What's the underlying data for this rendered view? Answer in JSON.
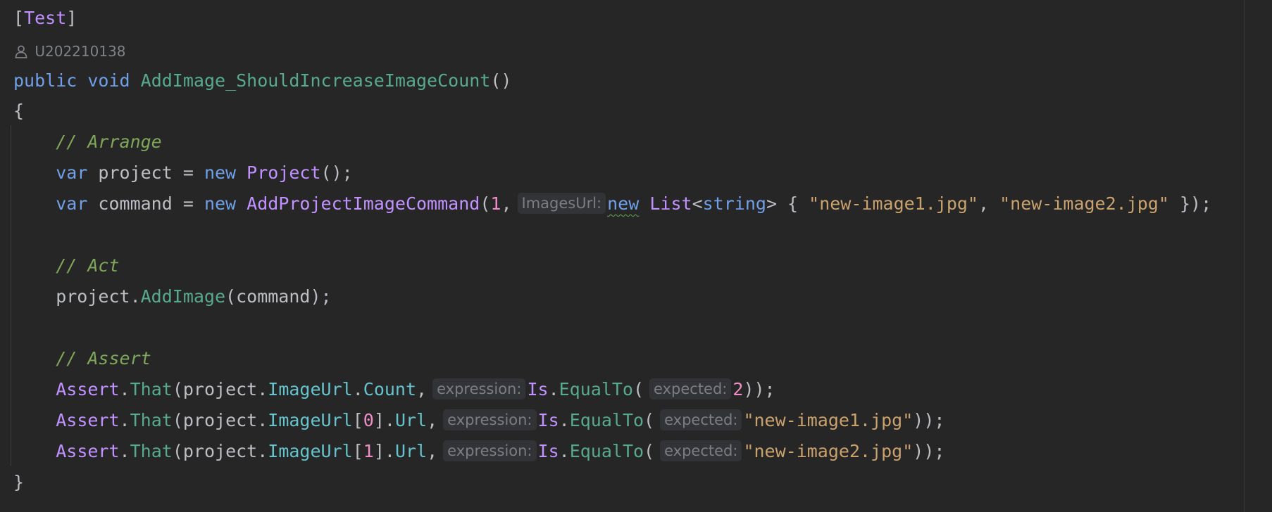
{
  "editor": {
    "author": {
      "icon": "user-icon",
      "name": "U202210138"
    },
    "lines": [
      {
        "id": "attribute",
        "tokens": [
          {
            "text": "[",
            "kind": "txt"
          },
          {
            "text": "Test",
            "kind": "cls"
          },
          {
            "text": "]",
            "kind": "txt"
          }
        ]
      },
      {
        "id": "method-signature",
        "tokens": [
          {
            "text": "public",
            "kind": "kw"
          },
          {
            "text": " ",
            "kind": "txt"
          },
          {
            "text": "void",
            "kind": "kw"
          },
          {
            "text": " ",
            "kind": "txt"
          },
          {
            "text": "AddImage_ShouldIncreaseImageCount",
            "kind": "fn"
          },
          {
            "text": "()",
            "kind": "txt"
          }
        ]
      },
      {
        "id": "open-brace",
        "tokens": [
          {
            "text": "{",
            "kind": "txt"
          }
        ]
      },
      {
        "id": "comment-arrange",
        "tokens": [
          {
            "text": "    ",
            "kind": "txt"
          },
          {
            "text": "// Arrange",
            "kind": "com"
          }
        ]
      },
      {
        "id": "var-project",
        "tokens": [
          {
            "text": "    ",
            "kind": "txt"
          },
          {
            "text": "var",
            "kind": "kw"
          },
          {
            "text": " project = ",
            "kind": "txt"
          },
          {
            "text": "new",
            "kind": "kw"
          },
          {
            "text": " ",
            "kind": "txt"
          },
          {
            "text": "Project",
            "kind": "cls"
          },
          {
            "text": "();",
            "kind": "txt"
          }
        ]
      },
      {
        "id": "var-command",
        "tokens": [
          {
            "text": "    ",
            "kind": "txt"
          },
          {
            "text": "var",
            "kind": "kw"
          },
          {
            "text": " command = ",
            "kind": "txt"
          },
          {
            "text": "new",
            "kind": "kw"
          },
          {
            "text": " ",
            "kind": "txt"
          },
          {
            "text": "AddProjectImageCommand",
            "kind": "cls"
          },
          {
            "text": "(",
            "kind": "txt"
          },
          {
            "text": "1",
            "kind": "num"
          },
          {
            "text": ",",
            "kind": "txt"
          },
          {
            "text": "ImagesUrl:",
            "kind": "hint"
          },
          {
            "text": "new",
            "kind": "kw",
            "squiggle": true
          },
          {
            "text": " ",
            "kind": "txt"
          },
          {
            "text": "List",
            "kind": "cls"
          },
          {
            "text": "<",
            "kind": "txt"
          },
          {
            "text": "string",
            "kind": "kw"
          },
          {
            "text": "> { ",
            "kind": "txt"
          },
          {
            "text": "\"new-image1.jpg\"",
            "kind": "str"
          },
          {
            "text": ", ",
            "kind": "txt"
          },
          {
            "text": "\"new-image2.jpg\"",
            "kind": "str"
          },
          {
            "text": " });",
            "kind": "txt"
          }
        ]
      },
      {
        "id": "blank-1",
        "tokens": []
      },
      {
        "id": "comment-act",
        "tokens": [
          {
            "text": "    ",
            "kind": "txt"
          },
          {
            "text": "// Act",
            "kind": "com"
          }
        ]
      },
      {
        "id": "add-image-call",
        "tokens": [
          {
            "text": "    project.",
            "kind": "txt"
          },
          {
            "text": "AddImage",
            "kind": "fn"
          },
          {
            "text": "(command);",
            "kind": "txt"
          }
        ]
      },
      {
        "id": "blank-2",
        "tokens": []
      },
      {
        "id": "comment-assert",
        "tokens": [
          {
            "text": "    ",
            "kind": "txt"
          },
          {
            "text": "// Assert",
            "kind": "com"
          }
        ]
      },
      {
        "id": "assert-count",
        "tokens": [
          {
            "text": "    ",
            "kind": "txt"
          },
          {
            "text": "Assert",
            "kind": "cls"
          },
          {
            "text": ".",
            "kind": "txt"
          },
          {
            "text": "That",
            "kind": "fn"
          },
          {
            "text": "(project.",
            "kind": "txt"
          },
          {
            "text": "ImageUrl",
            "kind": "prop"
          },
          {
            "text": ".",
            "kind": "txt"
          },
          {
            "text": "Count",
            "kind": "prop"
          },
          {
            "text": ",",
            "kind": "txt"
          },
          {
            "text": "expression:",
            "kind": "hint"
          },
          {
            "text": "Is",
            "kind": "cls"
          },
          {
            "text": ".",
            "kind": "txt"
          },
          {
            "text": "EqualTo",
            "kind": "fn"
          },
          {
            "text": "(",
            "kind": "txt"
          },
          {
            "text": "expected:",
            "kind": "hint"
          },
          {
            "text": "2",
            "kind": "num"
          },
          {
            "text": "));",
            "kind": "txt"
          }
        ]
      },
      {
        "id": "assert-url-0",
        "tokens": [
          {
            "text": "    ",
            "kind": "txt"
          },
          {
            "text": "Assert",
            "kind": "cls"
          },
          {
            "text": ".",
            "kind": "txt"
          },
          {
            "text": "That",
            "kind": "fn"
          },
          {
            "text": "(project.",
            "kind": "txt"
          },
          {
            "text": "ImageUrl",
            "kind": "prop"
          },
          {
            "text": "[",
            "kind": "txt"
          },
          {
            "text": "0",
            "kind": "num"
          },
          {
            "text": "].",
            "kind": "txt"
          },
          {
            "text": "Url",
            "kind": "prop"
          },
          {
            "text": ",",
            "kind": "txt"
          },
          {
            "text": "expression:",
            "kind": "hint"
          },
          {
            "text": "Is",
            "kind": "cls"
          },
          {
            "text": ".",
            "kind": "txt"
          },
          {
            "text": "EqualTo",
            "kind": "fn"
          },
          {
            "text": "(",
            "kind": "txt"
          },
          {
            "text": "expected:",
            "kind": "hint"
          },
          {
            "text": "\"new-image1.jpg\"",
            "kind": "str"
          },
          {
            "text": "));",
            "kind": "txt"
          }
        ]
      },
      {
        "id": "assert-url-1",
        "tokens": [
          {
            "text": "    ",
            "kind": "txt"
          },
          {
            "text": "Assert",
            "kind": "cls"
          },
          {
            "text": ".",
            "kind": "txt"
          },
          {
            "text": "That",
            "kind": "fn"
          },
          {
            "text": "(project.",
            "kind": "txt"
          },
          {
            "text": "ImageUrl",
            "kind": "prop"
          },
          {
            "text": "[",
            "kind": "txt"
          },
          {
            "text": "1",
            "kind": "num"
          },
          {
            "text": "].",
            "kind": "txt"
          },
          {
            "text": "Url",
            "kind": "prop"
          },
          {
            "text": ",",
            "kind": "txt"
          },
          {
            "text": "expression:",
            "kind": "hint"
          },
          {
            "text": "Is",
            "kind": "cls"
          },
          {
            "text": ".",
            "kind": "txt"
          },
          {
            "text": "EqualTo",
            "kind": "fn"
          },
          {
            "text": "(",
            "kind": "txt"
          },
          {
            "text": "expected:",
            "kind": "hint"
          },
          {
            "text": "\"new-image2.jpg\"",
            "kind": "str"
          },
          {
            "text": "));",
            "kind": "txt"
          }
        ]
      },
      {
        "id": "close-brace",
        "tokens": [
          {
            "text": "}",
            "kind": "txt"
          }
        ]
      }
    ]
  }
}
